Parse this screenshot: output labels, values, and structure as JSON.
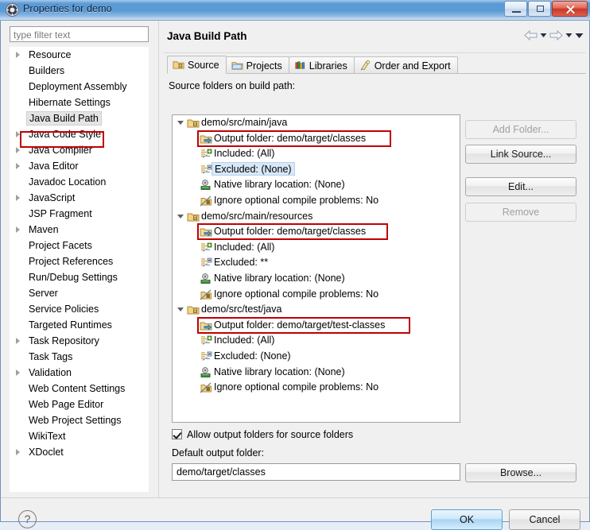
{
  "window": {
    "title": "Properties for demo",
    "icon": "settings-gear-icon",
    "controls": {
      "minimize": "Minimize",
      "maximize": "Maximize",
      "close": "Close"
    }
  },
  "sidebar": {
    "filter_placeholder": "type filter text",
    "filter_value": "",
    "selected": "Java Build Path",
    "items": [
      {
        "label": "Resource",
        "expandable": true
      },
      {
        "label": "Builders",
        "expandable": false
      },
      {
        "label": "Deployment Assembly",
        "expandable": false
      },
      {
        "label": "Hibernate Settings",
        "expandable": false
      },
      {
        "label": "Java Build Path",
        "expandable": false,
        "selected": true
      },
      {
        "label": "Java Code Style",
        "expandable": true
      },
      {
        "label": "Java Compiler",
        "expandable": true
      },
      {
        "label": "Java Editor",
        "expandable": true
      },
      {
        "label": "Javadoc Location",
        "expandable": false
      },
      {
        "label": "JavaScript",
        "expandable": true
      },
      {
        "label": "JSP Fragment",
        "expandable": false
      },
      {
        "label": "Maven",
        "expandable": true
      },
      {
        "label": "Project Facets",
        "expandable": false
      },
      {
        "label": "Project References",
        "expandable": false
      },
      {
        "label": "Run/Debug Settings",
        "expandable": false
      },
      {
        "label": "Server",
        "expandable": false
      },
      {
        "label": "Service Policies",
        "expandable": false
      },
      {
        "label": "Targeted Runtimes",
        "expandable": false
      },
      {
        "label": "Task Repository",
        "expandable": true
      },
      {
        "label": "Task Tags",
        "expandable": false
      },
      {
        "label": "Validation",
        "expandable": true
      },
      {
        "label": "Web Content Settings",
        "expandable": false
      },
      {
        "label": "Web Page Editor",
        "expandable": false
      },
      {
        "label": "Web Project Settings",
        "expandable": false
      },
      {
        "label": "WikiText",
        "expandable": false
      },
      {
        "label": "XDoclet",
        "expandable": true
      }
    ]
  },
  "page": {
    "title": "Java Build Path",
    "nav": {
      "back": "back-arrow-icon",
      "back_menu": "back-dropdown-icon",
      "forward": "forward-arrow-icon",
      "forward_menu": "forward-dropdown-icon",
      "menu": "view-menu-icon"
    },
    "tabs": [
      {
        "label": "Source",
        "icon": "source-folder-icon",
        "active": true
      },
      {
        "label": "Projects",
        "icon": "projects-folder-icon",
        "active": false
      },
      {
        "label": "Libraries",
        "icon": "libraries-icon",
        "active": false
      },
      {
        "label": "Order and Export",
        "icon": "order-export-icon",
        "active": false
      }
    ],
    "source_label": "Source folders on build path:",
    "tree": [
      {
        "label": "demo/src/main/java",
        "icon": "source-folder-icon",
        "level": 0,
        "expanded": true
      },
      {
        "label": "Output folder: demo/target/classes",
        "icon": "output-folder-icon",
        "level": 1,
        "annotated": true
      },
      {
        "label": "Included: (All)",
        "icon": "inclusion-filter-icon",
        "level": 1
      },
      {
        "label": "Excluded: (None)",
        "icon": "exclusion-filter-icon",
        "level": 1,
        "highlighted": true
      },
      {
        "label": "Native library location: (None)",
        "icon": "native-library-icon",
        "level": 1
      },
      {
        "label": "Ignore optional compile problems: No",
        "icon": "compile-problems-icon",
        "level": 1
      },
      {
        "label": "demo/src/main/resources",
        "icon": "source-folder-icon",
        "level": 0,
        "expanded": true
      },
      {
        "label": "Output folder: demo/target/classes",
        "icon": "output-folder-icon",
        "level": 1,
        "annotated": true
      },
      {
        "label": "Included: (All)",
        "icon": "inclusion-filter-icon",
        "level": 1
      },
      {
        "label": "Excluded: **",
        "icon": "exclusion-filter-icon",
        "level": 1
      },
      {
        "label": "Native library location: (None)",
        "icon": "native-library-icon",
        "level": 1
      },
      {
        "label": "Ignore optional compile problems: No",
        "icon": "compile-problems-icon",
        "level": 1
      },
      {
        "label": "demo/src/test/java",
        "icon": "source-folder-icon",
        "level": 0,
        "expanded": true
      },
      {
        "label": "Output folder: demo/target/test-classes",
        "icon": "output-folder-icon",
        "level": 1,
        "annotated": true
      },
      {
        "label": "Included: (All)",
        "icon": "inclusion-filter-icon",
        "level": 1
      },
      {
        "label": "Excluded: (None)",
        "icon": "exclusion-filter-icon",
        "level": 1
      },
      {
        "label": "Native library location: (None)",
        "icon": "native-library-icon",
        "level": 1
      },
      {
        "label": "Ignore optional compile problems: No",
        "icon": "compile-problems-icon",
        "level": 1
      }
    ],
    "side_buttons": [
      {
        "label": "Add Folder...",
        "enabled": false
      },
      {
        "label": "Link Source...",
        "enabled": true
      },
      {
        "label": "Edit...",
        "enabled": true
      },
      {
        "label": "Remove",
        "enabled": false
      }
    ],
    "allow_output_folders": {
      "label": "Allow output folders for source folders",
      "checked": true
    },
    "default_output_label": "Default output folder:",
    "default_output_value": "demo/target/classes",
    "browse_label": "Browse..."
  },
  "footer": {
    "help": "?",
    "ok": "OK",
    "cancel": "Cancel"
  },
  "colors": {
    "annotation": "#c00000",
    "titlebar": "#5b9bd5",
    "selection": "#d8e8f8",
    "default_button": "#a8d4f2"
  }
}
